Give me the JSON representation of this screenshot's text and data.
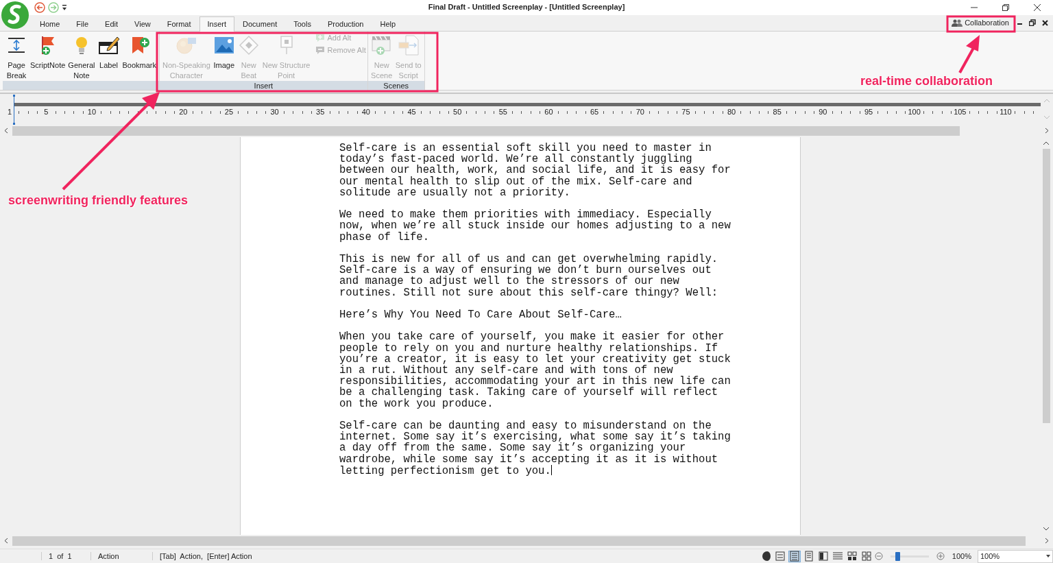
{
  "window": {
    "title": "Final Draft - Untitled Screenplay - [Untitled Screenplay]"
  },
  "menu_tabs": [
    {
      "label": "Home",
      "selected": false
    },
    {
      "label": "File",
      "selected": false
    },
    {
      "label": "Edit",
      "selected": false
    },
    {
      "label": "View",
      "selected": false
    },
    {
      "label": "Format",
      "selected": false
    },
    {
      "label": "Insert",
      "selected": true
    },
    {
      "label": "Document",
      "selected": false
    },
    {
      "label": "Tools",
      "selected": false
    },
    {
      "label": "Production",
      "selected": false
    },
    {
      "label": "Help",
      "selected": false
    }
  ],
  "collaboration_button": {
    "label": "Collaboration"
  },
  "ribbon": {
    "groups": [
      {
        "items": [
          {
            "kind": "large",
            "label": "Page\nBreak",
            "disabled": false
          },
          {
            "kind": "large",
            "label": "ScriptNote",
            "disabled": false
          },
          {
            "kind": "large",
            "label": "General\nNote",
            "disabled": false
          },
          {
            "kind": "large",
            "label": "Label",
            "disabled": false
          },
          {
            "kind": "large",
            "label": "Bookmark",
            "disabled": false
          }
        ]
      },
      {
        "caption": "Insert",
        "items": [
          {
            "kind": "large",
            "label": "Non-Speaking\nCharacter",
            "disabled": true
          },
          {
            "kind": "large",
            "label": "Image",
            "disabled": false
          },
          {
            "kind": "large",
            "label": "New\nBeat",
            "disabled": true
          },
          {
            "kind": "large",
            "label": "New Structure\nPoint",
            "disabled": true
          },
          {
            "kind": "small",
            "label": "Add Alt",
            "disabled": true
          },
          {
            "kind": "small",
            "label": "Remove Alt",
            "disabled": true
          }
        ]
      },
      {
        "caption": "Scenes",
        "items": [
          {
            "kind": "large",
            "label": "New\nScene",
            "disabled": true
          },
          {
            "kind": "large",
            "label": "Send to\nScript",
            "disabled": true
          }
        ]
      }
    ]
  },
  "ruler": {
    "labels": [
      "1",
      "5",
      "10",
      "20",
      "25",
      "30",
      "35",
      "40",
      "45",
      "50",
      "55",
      "60",
      "65",
      "70",
      "75",
      "80",
      "85",
      "90",
      "95",
      "100",
      "105",
      "110"
    ]
  },
  "document": {
    "paragraphs": [
      "Self-care is an essential soft skill you need to master in today’s fast-paced world. We’re all constantly juggling between our health, work, and social life, and it is easy for our mental health to slip out of the mix. Self-care and solitude are usually not a priority.",
      "We need to make them priorities with immediacy. Especially now, when we’re all stuck inside our homes adjusting to a new phase of life.",
      "This is new for all of us and can get overwhelming rapidly. Self-care is a way of ensuring we don’t burn ourselves out and manage to adjust well to the stressors of our new routines. Still not sure about this self-care thingy? Well:",
      "Here’s Why You Need To Care About Self-Care…",
      "When you take care of yourself, you make it easier for other people to rely on you and nurture healthy relationships. If you’re a creator, it is easy to let your creativity get stuck in a rut. Without any self-care and with tons of new responsibilities, accommodating your art in this new life can be a challenging task. Taking care of yourself will reflect on the work you produce.",
      "Self-care can be daunting and easy to misunderstand on the internet. Some say it’s exercising, what some say it’s taking a day off from the same. Some say it’s organizing your wardrobe, while some say it’s accepting it as it is without letting perfectionism get to you."
    ]
  },
  "status_bar": {
    "page": "1  of  1",
    "element": "Action",
    "hint": "[Tab]  Action,  [Enter] Action",
    "view_buttons": [
      {
        "selected": false
      },
      {
        "selected": true
      },
      {
        "selected": false
      },
      {
        "selected": false
      },
      {
        "selected": false
      },
      {
        "selected": false
      },
      {
        "selected": false
      }
    ],
    "zoom": {
      "level": 0.18,
      "reading": "100%"
    },
    "zoom_combo": {
      "value": "100%"
    }
  },
  "annotations": [
    {
      "text": "screenwriting friendly features"
    },
    {
      "text": "real-time collaboration"
    }
  ]
}
